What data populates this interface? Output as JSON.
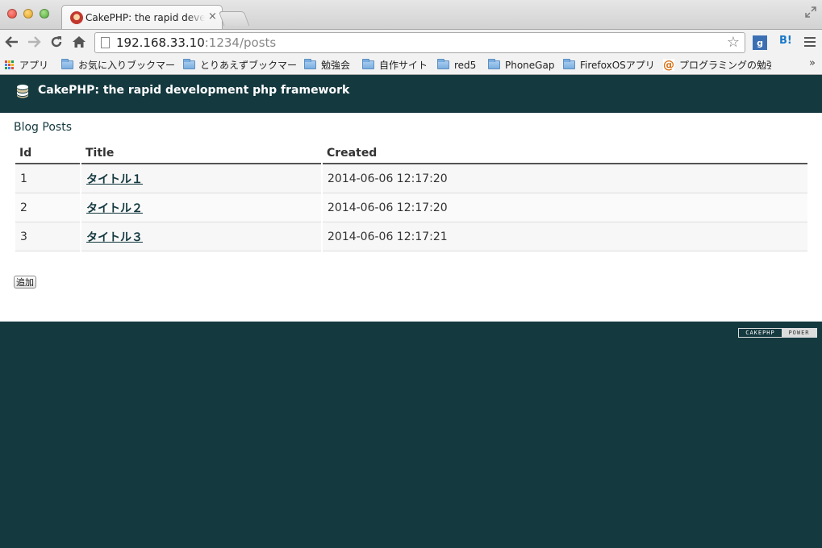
{
  "browser": {
    "tab_title": "CakePHP: the rapid development php framework",
    "tab_close": "×",
    "url_host": "192.168.33.10",
    "url_port": ":1234",
    "url_path": "/posts",
    "gplus_label": "g",
    "hatena_label": "B!",
    "overflow_label": "»",
    "bookmarks": [
      {
        "label": "アプリ",
        "icon": "apps-icon"
      },
      {
        "label": "お気に入りブックマー",
        "icon": "folder-icon"
      },
      {
        "label": "とりあえずブックマー",
        "icon": "folder-icon"
      },
      {
        "label": "勉強会",
        "icon": "folder-icon"
      },
      {
        "label": "自作サイト",
        "icon": "folder-icon"
      },
      {
        "label": "red5",
        "icon": "folder-icon"
      },
      {
        "label": "PhoneGap",
        "icon": "folder-icon"
      },
      {
        "label": "FirefoxOSアプリ",
        "icon": "folder-icon"
      },
      {
        "label": "プログラミングの勉強",
        "icon": "at-icon"
      }
    ]
  },
  "page": {
    "header_title": "CakePHP: the rapid development php framework",
    "heading": "Blog Posts",
    "columns": [
      "Id",
      "Title",
      "Created"
    ],
    "posts": [
      {
        "id": "1",
        "title": "タイトル１",
        "created": "2014-06-06 12:17:20"
      },
      {
        "id": "2",
        "title": "タイトル２",
        "created": "2014-06-06 12:17:20"
      },
      {
        "id": "3",
        "title": "タイトル３",
        "created": "2014-06-06 12:17:21"
      }
    ],
    "add_button": "追加",
    "power_left": "CAKEPHP",
    "power_right": "POWER"
  },
  "colors": {
    "brand": "#14393f",
    "link": "#14393f"
  }
}
